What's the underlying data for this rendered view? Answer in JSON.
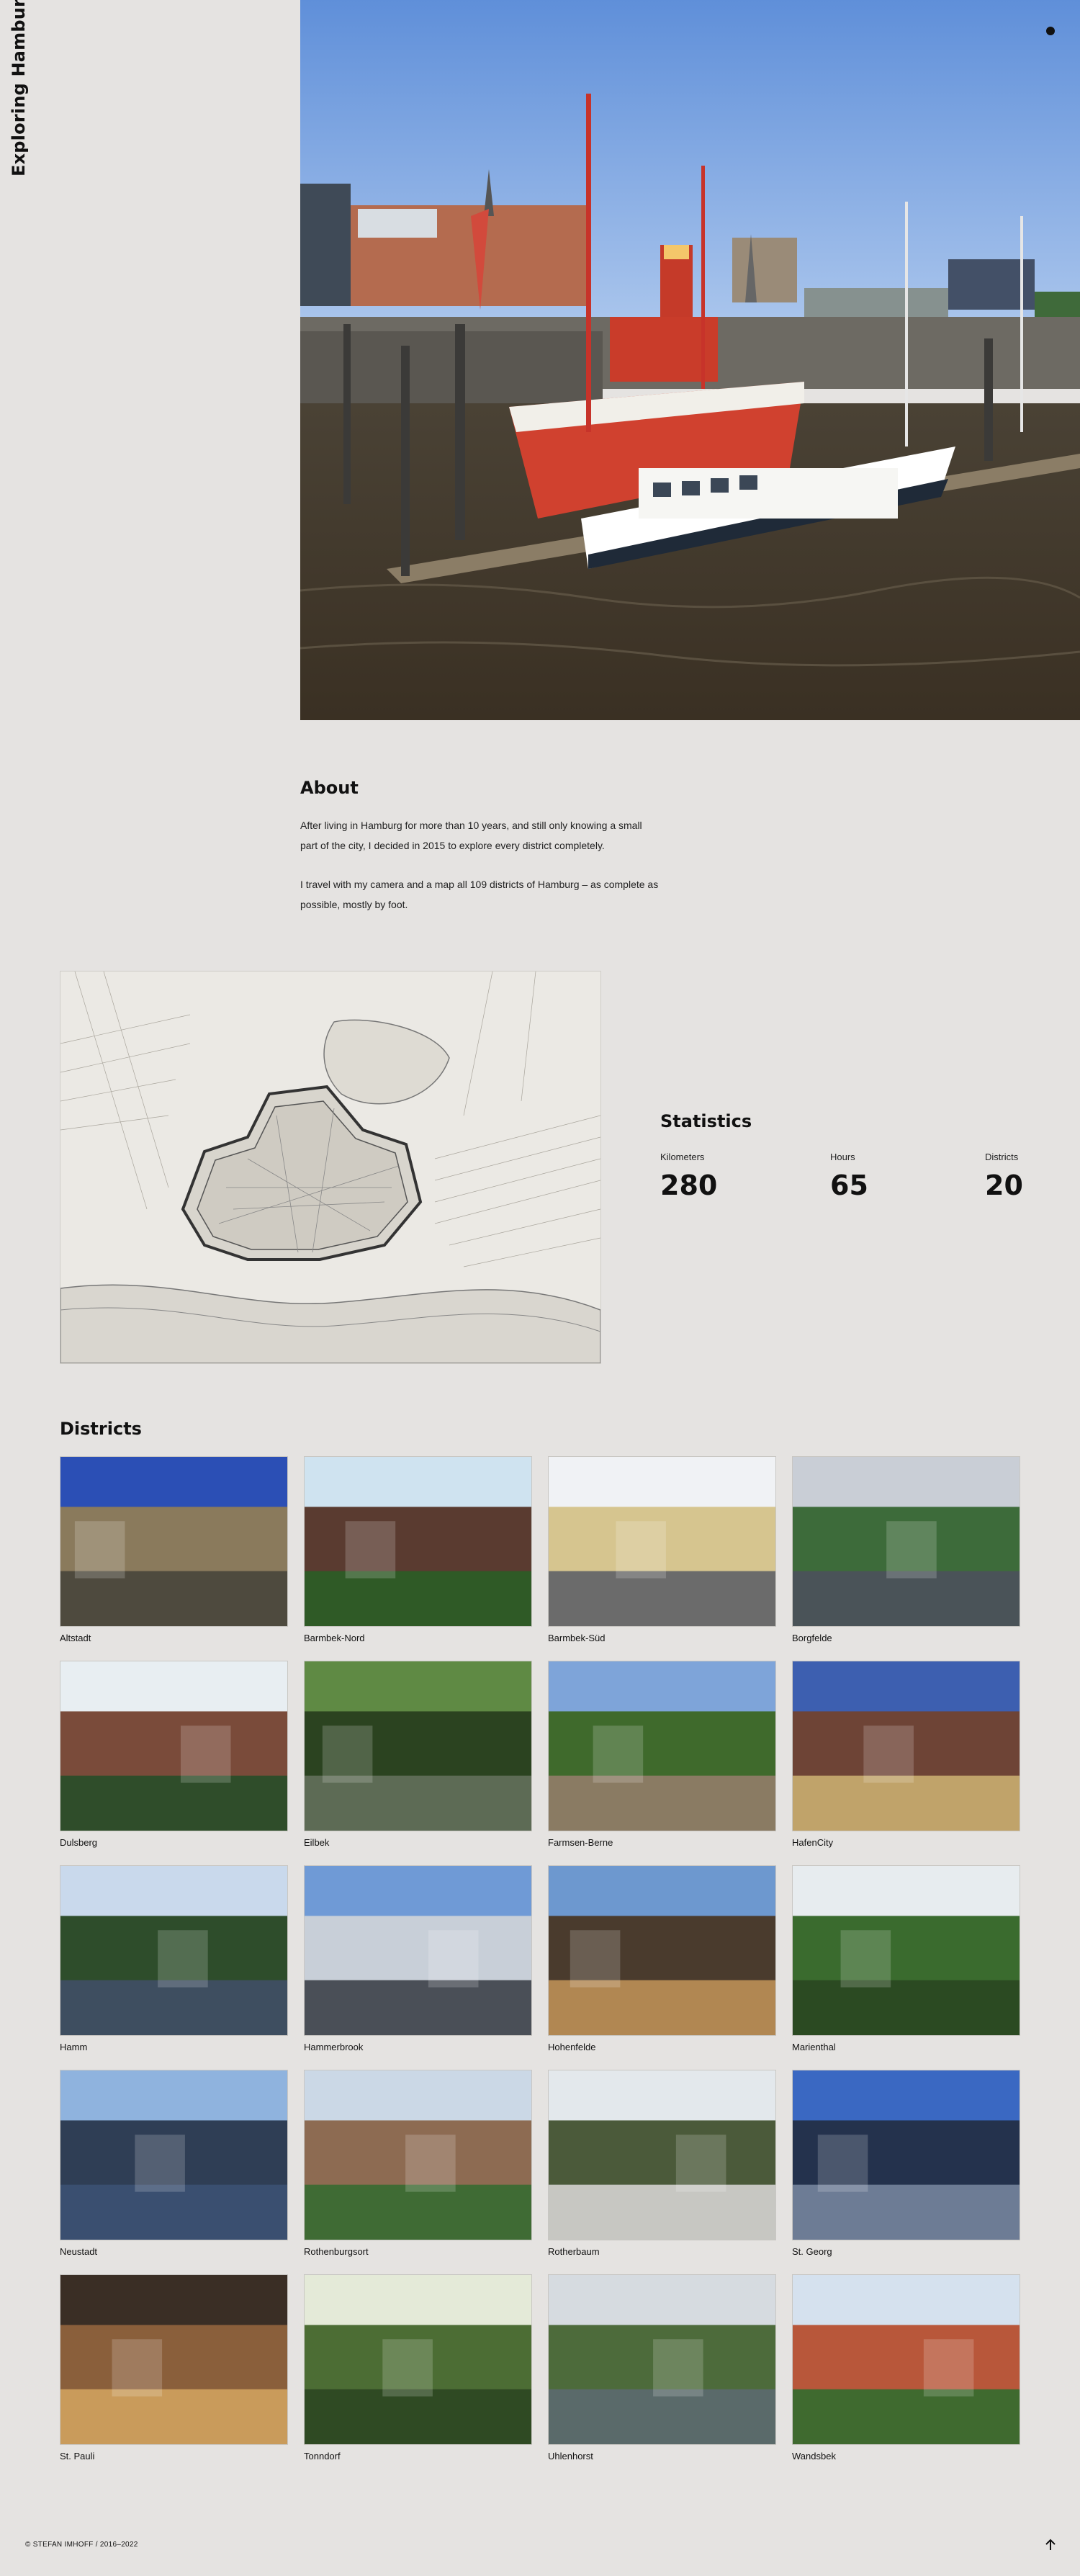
{
  "site": {
    "title": "Exploring Hamburg"
  },
  "hero": {
    "image": "harbor-photo-lightship-and-boats"
  },
  "about": {
    "heading": "About",
    "paragraph1": "After living in Hamburg for more than 10 years, and still only knowing a small part of the city, I decided in 2015 to explore every district completely.",
    "paragraph2": "I travel with my camera and a map all 109 districts of Hamburg – as complete as possible, mostly by foot."
  },
  "map": {
    "image": "historic-map-of-hamburg"
  },
  "statistics": {
    "heading": "Statistics",
    "items": [
      {
        "label": "Kilometers",
        "value": "280"
      },
      {
        "label": "Hours",
        "value": "65"
      },
      {
        "label": "Districts",
        "value": "20"
      }
    ]
  },
  "districts": {
    "heading": "Districts",
    "items": [
      {
        "name": "Altstadt"
      },
      {
        "name": "Barmbek-Nord"
      },
      {
        "name": "Barmbek-Süd"
      },
      {
        "name": "Borgfelde"
      },
      {
        "name": "Dulsberg"
      },
      {
        "name": "Eilbek"
      },
      {
        "name": "Farmsen-Berne"
      },
      {
        "name": "HafenCity"
      },
      {
        "name": "Hamm"
      },
      {
        "name": "Hammerbrook"
      },
      {
        "name": "Hohenfelde"
      },
      {
        "name": "Marienthal"
      },
      {
        "name": "Neustadt"
      },
      {
        "name": "Rothenburgsort"
      },
      {
        "name": "Rotherbaum"
      },
      {
        "name": "St. Georg"
      },
      {
        "name": "St. Pauli"
      },
      {
        "name": "Tonndorf"
      },
      {
        "name": "Uhlenhorst"
      },
      {
        "name": "Wandsbek"
      }
    ]
  },
  "footer": {
    "copyright": "© STEFAN IMHOFF / 2016–2022",
    "to_top_icon": "arrow-up-icon"
  }
}
